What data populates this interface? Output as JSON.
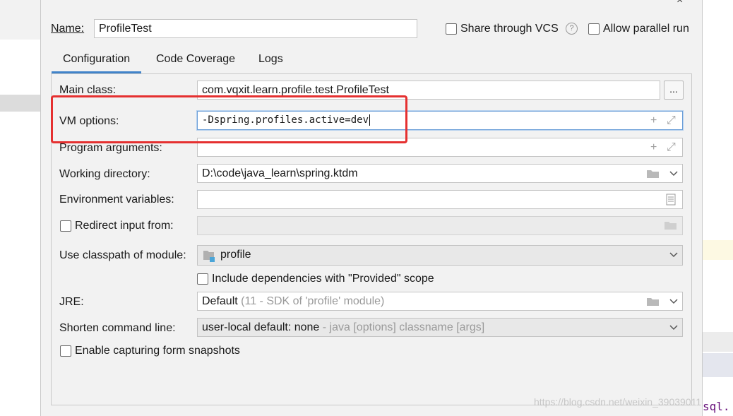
{
  "dialog": {
    "name_label": "Name:",
    "name_value": "ProfileTest",
    "share_vcs_label": "Share through VCS",
    "help_glyph": "?",
    "allow_parallel_label": "Allow parallel run",
    "close_glyph": "×"
  },
  "tabs": [
    {
      "label": "Configuration",
      "active": true
    },
    {
      "label": "Code Coverage",
      "active": false
    },
    {
      "label": "Logs",
      "active": false
    }
  ],
  "form": {
    "main_class_label": "Main class:",
    "main_class_value": "com.vqxit.learn.profile.test.ProfileTest",
    "browse_label": "...",
    "vm_options_label": "VM options:",
    "vm_options_value": "-Dspring.profiles.active=dev",
    "program_args_label": "Program arguments:",
    "program_args_value": "",
    "working_dir_label": "Working directory:",
    "working_dir_value": "D:\\code\\java_learn\\spring.ktdm",
    "env_vars_label": "Environment variables:",
    "env_vars_value": "",
    "redirect_input_label": "Redirect input from:",
    "redirect_input_value": "",
    "classpath_label": "Use classpath of module:",
    "classpath_value": "profile",
    "include_deps_label": "Include dependencies with \"Provided\" scope",
    "jre_label": "JRE:",
    "jre_value": "Default",
    "jre_hint": "(11 - SDK of 'profile' module)",
    "shorten_label": "Shorten command line:",
    "shorten_value": "user-local default: none",
    "shorten_hint": "- java [options] classname [args]",
    "snapshots_label": "Enable capturing form snapshots"
  },
  "icons": {
    "plus": "+",
    "expand": "⤢"
  },
  "editor": {
    "code_fragment": "sql."
  },
  "watermark": "https://blog.csdn.net/weixin_39039011",
  "colors": {
    "highlight_box": "#e53030",
    "tab_underline": "#4083c9",
    "focus_border": "#6b9fd8"
  }
}
